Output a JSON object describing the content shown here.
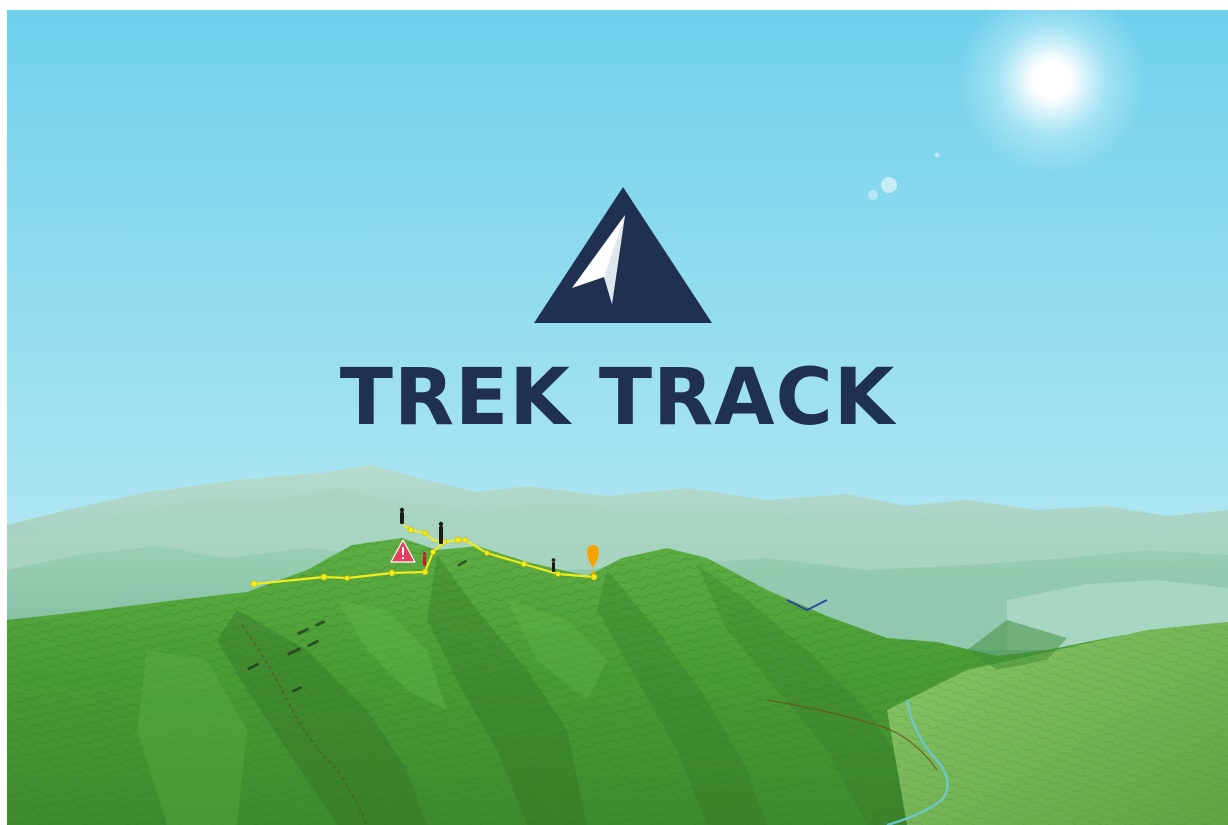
{
  "app": {
    "brand_name": "TREK TRACK",
    "logo_icon": "mountain-arrow-icon",
    "colors": {
      "brand_navy": "#1f3050",
      "sky_top": "#6fd0ec",
      "sky_bottom": "#c9eef6",
      "terrain_green": "#4e9a38",
      "route_yellow": "#f2ec1c",
      "warning_red": "#e0415c",
      "marker_orange": "#f5a300"
    }
  },
  "map": {
    "route_icon": "route-line-icon",
    "warning_icon": "warning-triangle-icon",
    "destination_icon": "destination-pin-icon",
    "hiker_icon": "hiker-marker-icon",
    "sun_icon": "sun-icon"
  }
}
